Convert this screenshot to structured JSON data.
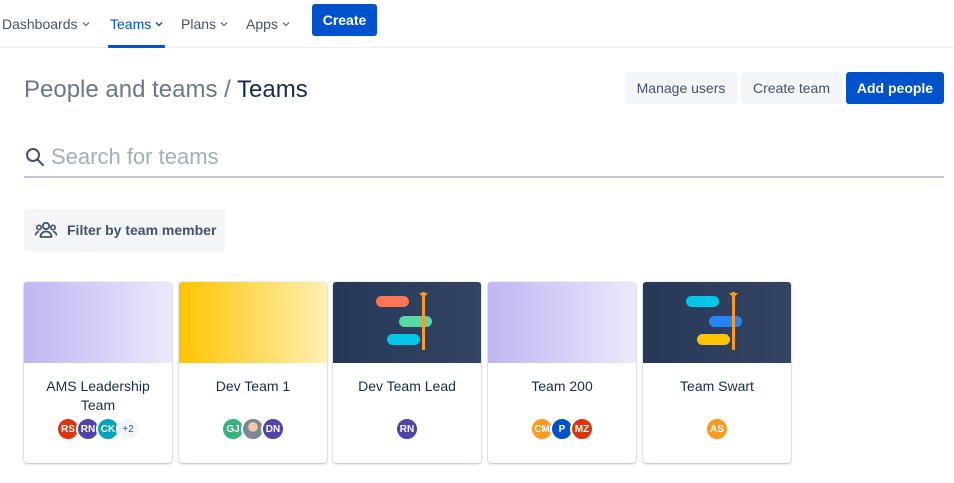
{
  "nav": {
    "items": [
      {
        "label": "Dashboards",
        "active": false
      },
      {
        "label": "Teams",
        "active": true
      },
      {
        "label": "Plans",
        "active": false
      },
      {
        "label": "Apps",
        "active": false
      }
    ],
    "create_label": "Create"
  },
  "header": {
    "breadcrumb_parent": "People and teams",
    "separator": " / ",
    "title": "Teams",
    "manage_users_label": "Manage users",
    "create_team_label": "Create team",
    "add_people_label": "Add people"
  },
  "search": {
    "placeholder": "Search for teams",
    "value": ""
  },
  "filter": {
    "label": "Filter by team member"
  },
  "teams": [
    {
      "name": "AMS Leadership Team",
      "banner": "lavender",
      "members": [
        {
          "initials": "RS",
          "color": "#de350b"
        },
        {
          "initials": "RN",
          "color": "#5243aa"
        },
        {
          "initials": "CK",
          "color": "#00a3bf"
        },
        {
          "initials": "+2",
          "color": "#f4f5f7"
        }
      ]
    },
    {
      "name": "Dev Team 1",
      "banner": "yellow",
      "members": [
        {
          "initials": "GJ",
          "color": "#36b37e"
        },
        {
          "initials": "",
          "color": "photo"
        },
        {
          "initials": "DN",
          "color": "#5243aa"
        }
      ]
    },
    {
      "name": "Dev Team Lead",
      "banner": "navy-roadmap",
      "members": [
        {
          "initials": "RN",
          "color": "#5243aa"
        }
      ]
    },
    {
      "name": "Team 200",
      "banner": "lavender",
      "members": [
        {
          "initials": "CM",
          "color": "#ff991f"
        },
        {
          "initials": "P",
          "color": "#0052cc"
        },
        {
          "initials": "MZ",
          "color": "#de350b"
        }
      ]
    },
    {
      "name": "Team Swart",
      "banner": "navy-roadmap-blue",
      "members": [
        {
          "initials": "AS",
          "color": "#ff991f"
        }
      ]
    }
  ],
  "colors": {
    "primary": "#0052cc",
    "text": "#172b4d",
    "subtle_bg": "#f4f5f7"
  }
}
